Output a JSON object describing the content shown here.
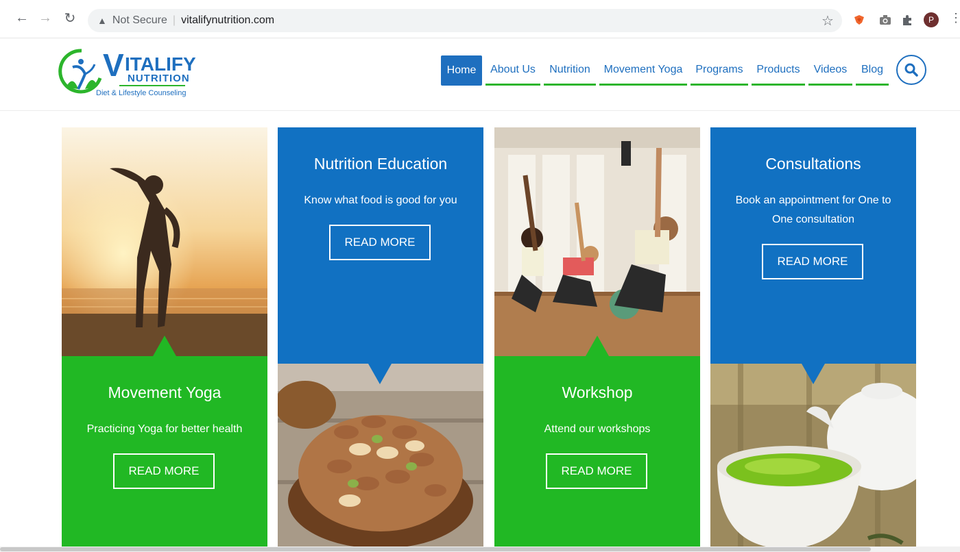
{
  "browser": {
    "security_label": "Not Secure",
    "url": "vitalifynutrition.com",
    "avatar_initial": "P"
  },
  "site": {
    "logo": {
      "v": "V",
      "italify": "ITALIFY",
      "nutrition": "NUTRITION",
      "tagline": "Diet & Lifestyle Counseling"
    },
    "nav": {
      "home": "Home",
      "about": "About Us",
      "nutrition": "Nutrition",
      "movement_yoga": "Movement Yoga",
      "programs": "Programs",
      "products": "Products",
      "videos": "Videos",
      "blog": "Blog"
    }
  },
  "tiles": {
    "movement_yoga": {
      "title": "Movement Yoga",
      "text": "Practicing Yoga for better health",
      "button": "READ MORE"
    },
    "nutrition_education": {
      "title": "Nutrition Education",
      "text": "Know what food is good for you",
      "button": "READ MORE"
    },
    "workshop": {
      "title": "Workshop",
      "text": "Attend our workshops",
      "button": "READ MORE"
    },
    "consultations": {
      "title": "Consultations",
      "text": "Book an appointment for One to One consultation",
      "button": "READ MORE"
    }
  },
  "colors": {
    "brand_blue": "#1171c2",
    "brand_green": "#21b824"
  }
}
